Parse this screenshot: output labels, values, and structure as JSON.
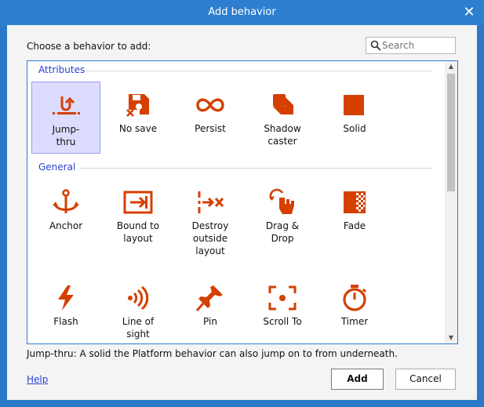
{
  "dialog": {
    "title": "Add behavior",
    "close_glyph": "✕"
  },
  "prompt": "Choose a behavior to add:",
  "search": {
    "placeholder": "Search",
    "value": ""
  },
  "accent_color": "#d44000",
  "sections": [
    {
      "title": "Attributes",
      "items": [
        {
          "label": "Jump-\nthru",
          "icon": "jump-thru-icon",
          "selected": true
        },
        {
          "label": "No save",
          "icon": "no-save-icon"
        },
        {
          "label": "Persist",
          "icon": "infinity-icon"
        },
        {
          "label": "Shadow\ncaster",
          "icon": "shadow-caster-icon"
        },
        {
          "label": "Solid",
          "icon": "solid-square-icon"
        }
      ]
    },
    {
      "title": "General",
      "items": [
        {
          "label": "Anchor",
          "icon": "anchor-icon"
        },
        {
          "label": "Bound to\nlayout",
          "icon": "bound-to-layout-icon"
        },
        {
          "label": "Destroy\noutside\nlayout",
          "icon": "destroy-outside-icon"
        },
        {
          "label": "Drag &\nDrop",
          "icon": "drag-drop-hand-icon"
        },
        {
          "label": "Fade",
          "icon": "fade-icon"
        },
        {
          "label": "Flash",
          "icon": "lightning-icon"
        },
        {
          "label": "Line of\nsight",
          "icon": "line-of-sight-icon"
        },
        {
          "label": "Pin",
          "icon": "pushpin-icon"
        },
        {
          "label": "Scroll To",
          "icon": "scroll-to-icon"
        },
        {
          "label": "Timer",
          "icon": "stopwatch-icon"
        }
      ]
    }
  ],
  "description": "Jump-thru: A solid the Platform behavior can also jump on to from underneath.",
  "footer": {
    "help": "Help",
    "add": "Add",
    "cancel": "Cancel"
  }
}
